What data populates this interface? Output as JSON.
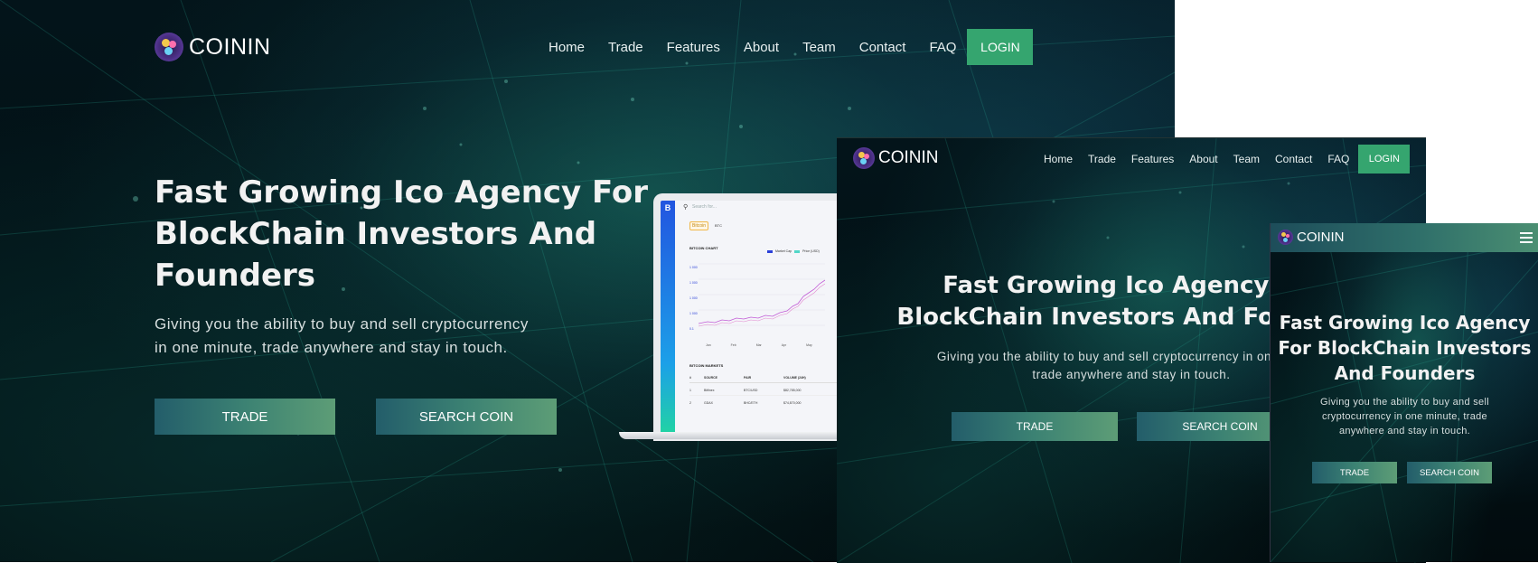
{
  "brand": {
    "name": "COININ"
  },
  "nav": {
    "items": [
      "Home",
      "Trade",
      "Features",
      "About",
      "Team",
      "Contact",
      "FAQ"
    ],
    "login": "LOGIN"
  },
  "hero": {
    "title_desktop": [
      "Fast Growing Ico Agency For",
      "BlockChain Investors And",
      "Founders"
    ],
    "title_tablet": [
      "Fast Growing Ico Agency For",
      "BlockChain Investors And Founders"
    ],
    "title_mobile": [
      "Fast Growing Ico Agency",
      "For BlockChain Investors",
      "And Founders"
    ],
    "subtitle_desktop": [
      "Giving you the ability to buy and sell cryptocurrency",
      "in one minute, trade anywhere and stay in touch."
    ],
    "subtitle_tablet": [
      "Giving you the ability to buy and sell cryptocurrency in one minute,",
      "trade anywhere and stay in touch."
    ],
    "subtitle_mobile": [
      "Giving you the ability to buy and sell",
      "cryptocurrency in one minute, trade",
      "anywhere and stay in touch."
    ],
    "trade_button": "TRADE",
    "search_button": "SEARCH COIN"
  },
  "dashboard": {
    "search_placeholder": "Search for...",
    "coin_badge": "Bitcoin",
    "coin_tag": "BTC",
    "chart_title": "BITCOIN CHART",
    "legend": [
      "Market Cap",
      "Price (USD)"
    ],
    "y_ticks": [
      "1 000",
      "1 000",
      "1 000",
      "1 000",
      "0.1"
    ],
    "x_ticks": [
      "Jan",
      "Feb",
      "Mar",
      "Apr",
      "May"
    ],
    "markets_title": "BITCOIN MARKETS",
    "table_headers": [
      "#",
      "SOURCE",
      "PAIR",
      "VOLUME (24H)"
    ],
    "table_rows": [
      [
        "1",
        "Bitfinex",
        "BTC/USD",
        "$82,785,000"
      ],
      [
        "2",
        "GDAX",
        "BHC/ETH",
        "$74,870,000"
      ]
    ],
    "colors": {
      "sidebar": "#2255e0",
      "market_cap": "#2a40d8",
      "price": "#52d6c8",
      "line": "#c25bd6"
    }
  },
  "colors": {
    "login": "#35a56f",
    "btn_start": "#235d6a",
    "btn_end": "#5d9d76"
  }
}
